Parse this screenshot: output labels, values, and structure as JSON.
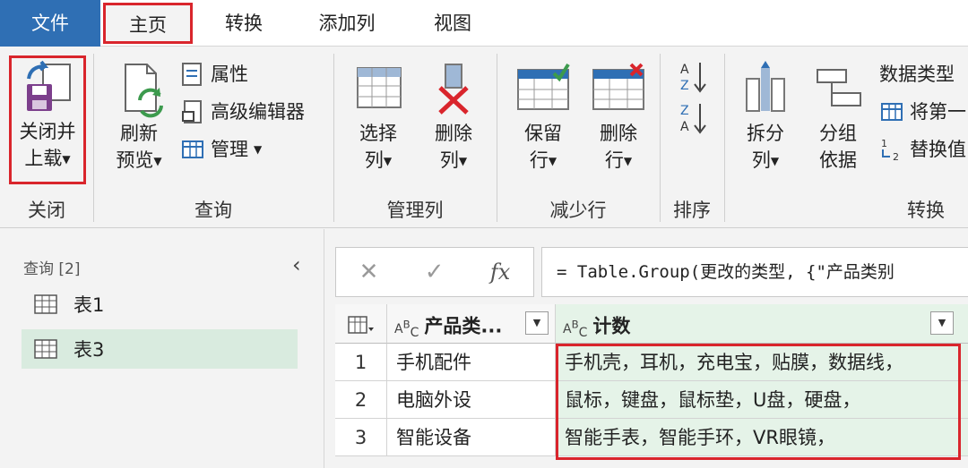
{
  "tabs": {
    "file": "文件",
    "home": "主页",
    "transform": "转换",
    "add_column": "添加列",
    "view": "视图"
  },
  "ribbon": {
    "close_group": {
      "close_load_line1": "关闭并",
      "close_load_line2": "上载",
      "label": "关闭"
    },
    "query_group": {
      "refresh_line1": "刷新",
      "refresh_line2": "预览",
      "properties": "属性",
      "advanced_editor": "高级编辑器",
      "manage": "管理",
      "label": "查询"
    },
    "manage_columns_group": {
      "choose_line1": "选择",
      "choose_line2": "列",
      "remove_line1": "删除",
      "remove_line2": "列",
      "label": "管理列"
    },
    "reduce_rows_group": {
      "keep_line1": "保留",
      "keep_line2": "行",
      "remove_line1": "删除",
      "remove_line2": "行",
      "label": "减少行"
    },
    "sort_group": {
      "label": "排序"
    },
    "transform_group": {
      "split_line1": "拆分",
      "split_line2": "列",
      "groupby_line1": "分组",
      "groupby_line2": "依据",
      "data_type": "数据类型",
      "first_row": "将第一",
      "replace": "替换值",
      "label": "转换"
    }
  },
  "queries": {
    "header": "查询 [2]",
    "items": [
      "表1",
      "表3"
    ]
  },
  "formula": "= Table.Group(更改的类型, {\"产品类别",
  "grid": {
    "columns": [
      "产品类...",
      "计数"
    ],
    "rows": [
      {
        "num": "1",
        "category": "手机配件",
        "count": "手机壳，耳机，充电宝，贴膜，数据线，"
      },
      {
        "num": "2",
        "category": "电脑外设",
        "count": "鼠标，键盘，鼠标垫，U盘，硬盘，"
      },
      {
        "num": "3",
        "category": "智能设备",
        "count": "智能手表，智能手环，VR眼镜，"
      }
    ]
  },
  "colors": {
    "accent": "#2f6fb4",
    "highlight": "#d9252c",
    "selected_query": "#d9ebdf",
    "selected_column": "#e5f3e8"
  }
}
